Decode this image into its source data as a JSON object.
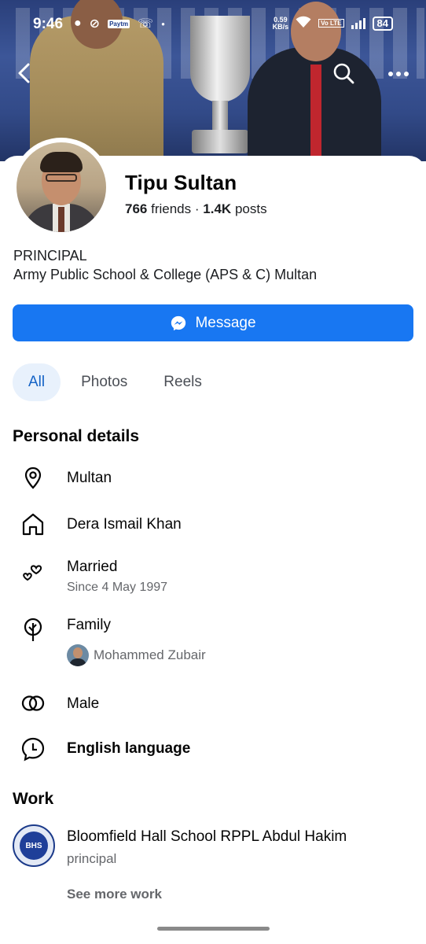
{
  "status_bar": {
    "time": "9:46",
    "net_speed_value": "0.59",
    "net_speed_unit": "KB/s",
    "volte": "Vo LTE",
    "battery": "84",
    "paytm": "Paytm"
  },
  "profile": {
    "name": "Tipu Sultan",
    "friends_count": "766",
    "friends_label": "friends",
    "separator": "·",
    "posts_count": "1.4K",
    "posts_label": "posts",
    "bio_line1": "PRINCIPAL",
    "bio_line2": "Army Public School & College (APS & C) Multan"
  },
  "actions": {
    "message_label": "Message"
  },
  "tabs": [
    {
      "label": "All",
      "active": true
    },
    {
      "label": "Photos",
      "active": false
    },
    {
      "label": "Reels",
      "active": false
    }
  ],
  "personal_details": {
    "title": "Personal details",
    "current_city": "Multan",
    "hometown": "Dera Ismail Khan",
    "relationship": "Married",
    "relationship_since": "Since 4 May 1997",
    "family_label": "Family",
    "family_member": "Mohammed Zubair",
    "gender": "Male",
    "language": "English language"
  },
  "work": {
    "title": "Work",
    "employer": "Bloomfield Hall School RPPL Abdul Hakim",
    "position": "principal",
    "logo_text": "BHS",
    "see_more": "See more work"
  },
  "colors": {
    "primary": "#1877f2",
    "tab_active_bg": "#e8f1fc",
    "tab_active_text": "#1463c6",
    "secondary_text": "#65676b"
  }
}
